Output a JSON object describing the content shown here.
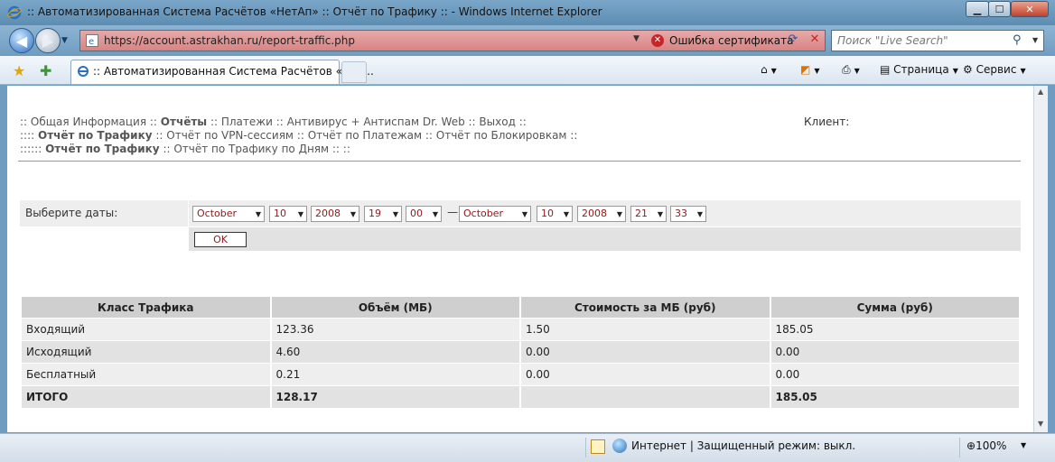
{
  "window": {
    "title": ":: Автоматизированная Система Расчётов «НетАп» :: Отчёт по Трафику :: - Windows Internet Explorer"
  },
  "addressbar": {
    "url": "https://account.astrakhan.ru/report-traffic.php",
    "cert_error": "Ошибка сертификата"
  },
  "search": {
    "placeholder": "Поиск \"Live Search\""
  },
  "tab": {
    "label": ":: Автоматизированная Система Расчётов «Нет..."
  },
  "commandbar": {
    "page": "Страница",
    "tools": "Сервис"
  },
  "nav": {
    "row1": [
      {
        "prefix": ":: ",
        "label": "Общая Информация",
        "bold": false
      },
      {
        "prefix": " :: ",
        "label": "Отчёты",
        "bold": true
      },
      {
        "prefix": " :: ",
        "label": "Платежи",
        "bold": false
      },
      {
        "prefix": " :: ",
        "label": "Антивирус + Антиспам Dr. Web",
        "bold": false
      },
      {
        "prefix": " :: ",
        "label": "Выход",
        "bold": false
      },
      {
        "prefix": " ::",
        "label": "",
        "bold": false
      }
    ],
    "row2": [
      {
        "prefix": ":::: ",
        "label": "Отчёт по Трафику",
        "bold": true
      },
      {
        "prefix": " :: ",
        "label": "Отчёт по VPN-сессиям",
        "bold": false
      },
      {
        "prefix": " :: ",
        "label": "Отчёт по Платежам",
        "bold": false
      },
      {
        "prefix": " :: ",
        "label": "Отчёт по Блокировкам",
        "bold": false
      },
      {
        "prefix": " ::",
        "label": "",
        "bold": false
      }
    ],
    "row3": [
      {
        "prefix": ":::::: ",
        "label": "Отчёт по Трафику",
        "bold": true
      },
      {
        "prefix": " :: ",
        "label": "Отчёт по Трафику по Дням",
        "bold": false
      },
      {
        "prefix": " :: ::",
        "label": "",
        "bold": false
      }
    ],
    "client_label": "Клиент:"
  },
  "dates": {
    "label": "Выберите даты:",
    "from": {
      "month": "October",
      "day": "10",
      "year": "2008",
      "hour": "19",
      "minute": "00"
    },
    "separator": "—",
    "to": {
      "month": "October",
      "day": "10",
      "year": "2008",
      "hour": "21",
      "minute": "33"
    },
    "ok_label": "OK"
  },
  "table": {
    "headers": [
      "Класс Трафика",
      "Объём (МБ)",
      "Стоимость за МБ (руб)",
      "Сумма (руб)"
    ],
    "rows": [
      [
        "Входящий",
        "123.36",
        "1.50",
        "185.05"
      ],
      [
        "Исходящий",
        "4.60",
        "0.00",
        "0.00"
      ],
      [
        "Бесплатный",
        "0.21",
        "0.00",
        "0.00"
      ]
    ],
    "total": [
      "ИТОГО",
      "128.17",
      "",
      "185.05"
    ]
  },
  "statusbar": {
    "zone": "Интернет | Защищенный режим: выкл.",
    "zoom": "100%"
  }
}
